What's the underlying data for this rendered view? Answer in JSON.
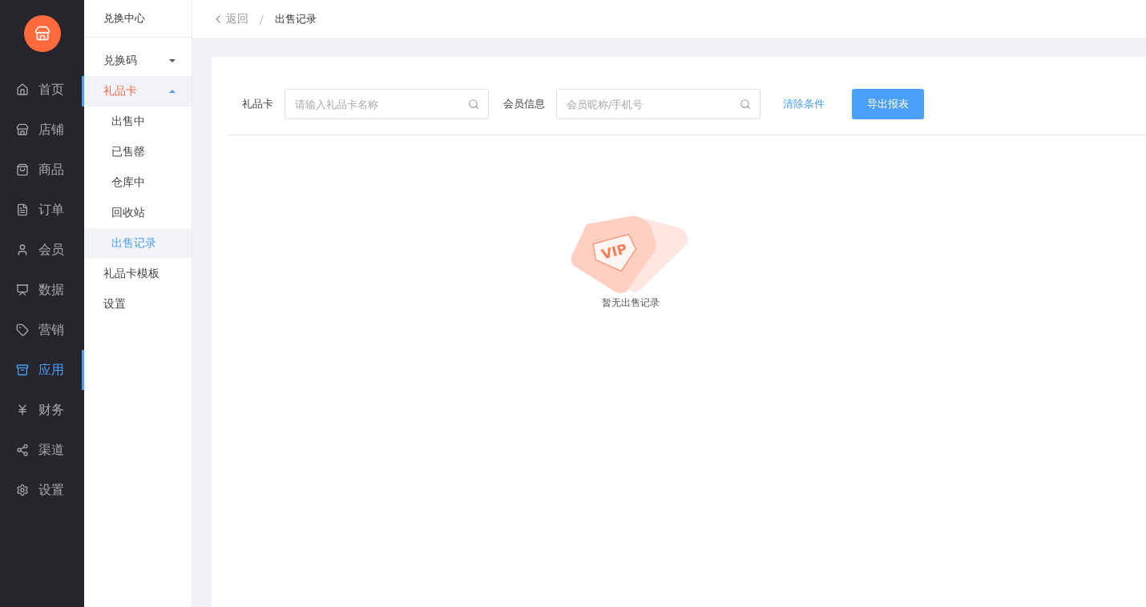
{
  "main_nav": [
    {
      "label": "首页",
      "selected": false
    },
    {
      "label": "店铺",
      "selected": false
    },
    {
      "label": "商品",
      "selected": false
    },
    {
      "label": "订单",
      "selected": false
    },
    {
      "label": "会员",
      "selected": false
    },
    {
      "label": "数据",
      "selected": false
    },
    {
      "label": "营销",
      "selected": false
    },
    {
      "label": "应用",
      "selected": true
    },
    {
      "label": "财务",
      "selected": false
    },
    {
      "label": "渠道",
      "selected": false
    },
    {
      "label": "设置",
      "selected": false
    }
  ],
  "sub_nav": {
    "title": "兑换中心",
    "items": [
      {
        "label": "兑换码",
        "selected": false,
        "expanded": false
      },
      {
        "label": "礼品卡",
        "selected": true,
        "expanded": true,
        "children": [
          {
            "label": "出售中",
            "selected": false
          },
          {
            "label": "已售罄",
            "selected": false
          },
          {
            "label": "仓库中",
            "selected": false
          },
          {
            "label": "回收站",
            "selected": false
          },
          {
            "label": "出售记录",
            "selected": true
          }
        ]
      },
      {
        "label": "礼品卡模板",
        "selected": false
      },
      {
        "label": "设置",
        "selected": false
      }
    ]
  },
  "breadcrumb": {
    "back": "返回",
    "separator": "/",
    "current": "出售记录"
  },
  "filters": [
    {
      "label": "礼品卡",
      "placeholder": "请输入礼品卡名称"
    },
    {
      "label": "会员信息",
      "placeholder": "会员昵称/手机号"
    }
  ],
  "clear_link": "清除条件",
  "export_button": "导出报表",
  "empty": {
    "badge": "VIP",
    "message": "暂无出售记录"
  }
}
